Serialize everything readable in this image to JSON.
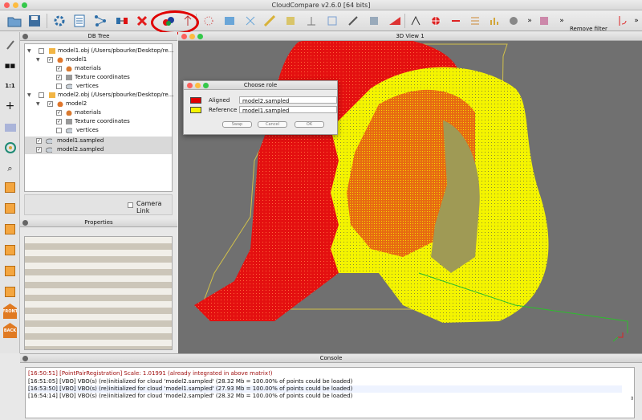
{
  "window": {
    "title": "CloudCompare v2.6.0 [64 bits]"
  },
  "toolbar": {
    "remove_filter": "Remove filter",
    "overflow": "»"
  },
  "left_toolbar": {
    "label_front": "FRONT",
    "label_back": "BACK",
    "ratio": "1:1"
  },
  "db_tree": {
    "title": "DB Tree",
    "camera_link": "Camera Link",
    "items": [
      {
        "label": "model1.obj (/Users/pbourke/Desktop/re...",
        "checked": false
      },
      {
        "label": "model1",
        "checked": true
      },
      {
        "label": "materials",
        "checked": true
      },
      {
        "label": "Texture coordinates",
        "checked": true
      },
      {
        "label": "vertices",
        "checked": false
      },
      {
        "label": "model2.obj (/Users/pbourke/Desktop/re...",
        "checked": false
      },
      {
        "label": "model2",
        "checked": true
      },
      {
        "label": "materials",
        "checked": true
      },
      {
        "label": "Texture coordinates",
        "checked": true
      },
      {
        "label": "vertices",
        "checked": false
      },
      {
        "label": "model1.sampled",
        "checked": true
      },
      {
        "label": "model2.sampled",
        "checked": true
      }
    ]
  },
  "properties": {
    "title": "Properties"
  },
  "view3d": {
    "title": "3D View 1"
  },
  "choose_role": {
    "title": "Choose role",
    "aligned_label": "Aligned",
    "aligned_value": "model2.sampled",
    "aligned_color": "#e00000",
    "reference_label": "Reference",
    "reference_value": "model1.sampled",
    "reference_color": "#f5f500",
    "btn_swap": "Swap",
    "btn_cancel": "Cancel",
    "btn_ok": "OK"
  },
  "console": {
    "title": "Console",
    "lines": [
      {
        "text": "[16:50:51] [PointPairRegistration] Scale: 1.01991 (already integrated in above matrix!)",
        "color": "#a01010"
      },
      {
        "text": "[16:51:05] [VBO] VBO(s) (re)initialized for cloud 'model2.sampled' (28.32 Mb = 100.00% of points could be loaded)",
        "color": "#111111"
      },
      {
        "text": "[16:53:50] [VBO] VBO(s) (re)initialized for cloud 'model1.sampled' (27.93 Mb = 100.00% of points could be loaded)",
        "color": "#111111"
      },
      {
        "text": "[16:54:14] [VBO] VBO(s) (re)initialized for cloud 'model2.sampled' (28.32 Mb = 100.00% of points could be loaded)",
        "color": "#111111"
      }
    ]
  },
  "colors": {
    "aligned": "#e00000",
    "reference": "#f5f500",
    "annotation": "#e00000",
    "background": "#707070"
  }
}
